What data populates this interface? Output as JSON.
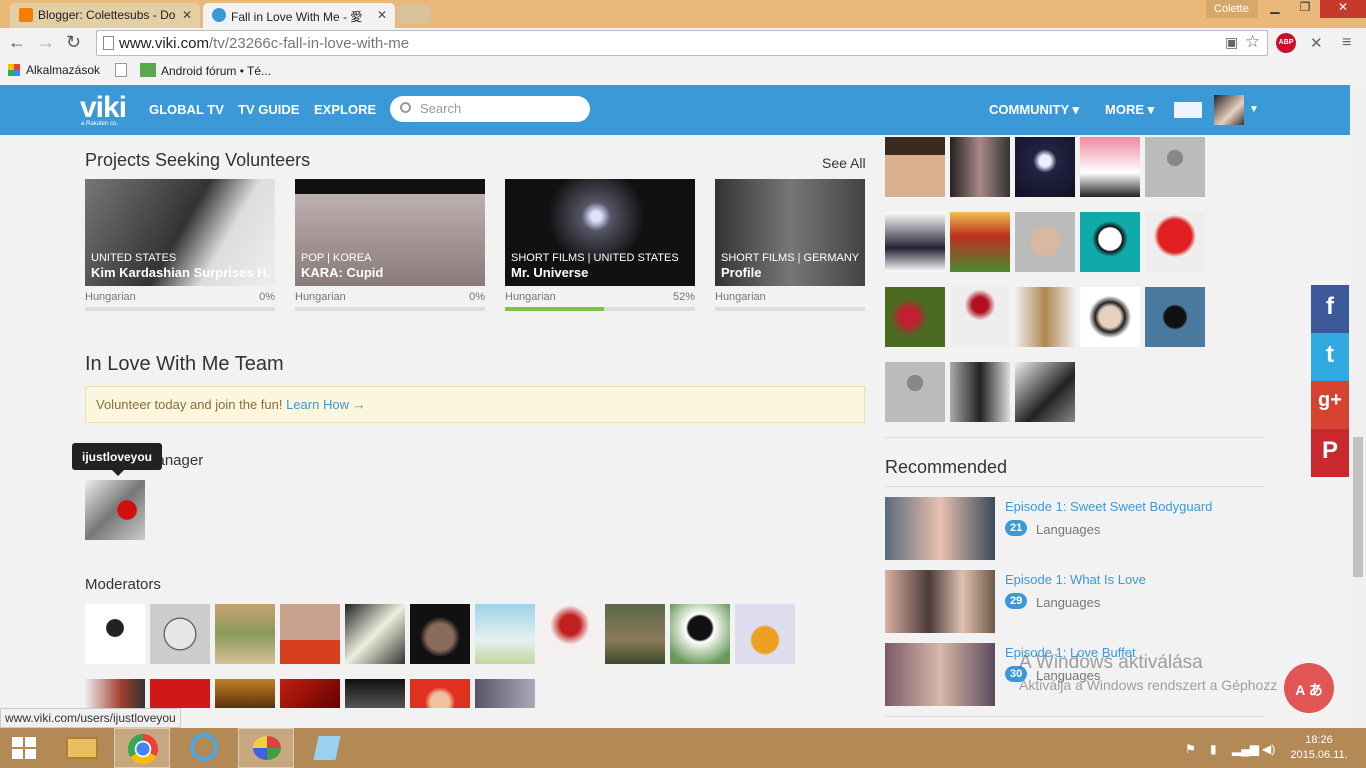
{
  "browser": {
    "tabs": [
      {
        "title": "Blogger: Colettesubs - Do",
        "favicon_color": "#f57d00"
      },
      {
        "title": "Fall in Love With Me - 愛",
        "favicon_color": "#3b99d8"
      }
    ],
    "window_user": "Colette",
    "url_host": "www.viki.com",
    "url_path": "/tv/23266c-fall-in-love-with-me",
    "abp_count": "ABP",
    "bookmarks": [
      "Alkalmazások",
      "Android fórum • Té..."
    ]
  },
  "viki": {
    "logo": "viki",
    "logo_sub": "a Rakuten co.",
    "nav": [
      "GLOBAL TV",
      "TV GUIDE",
      "EXPLORE"
    ],
    "search_placeholder": "Search",
    "right_nav": [
      "COMMUNITY",
      "MORE"
    ]
  },
  "projects": {
    "title": "Projects Seeking Volunteers",
    "see_all": "See All",
    "cards": [
      {
        "tag": "UNITED STATES",
        "title": "Kim Kardashian Surprises H...",
        "lang": "Hungarian",
        "pct": "0%",
        "progress": 0,
        "color": "#5a5a5a"
      },
      {
        "tag": "POP | KOREA",
        "title": "KARA: Cupid",
        "lang": "Hungarian",
        "pct": "0%",
        "progress": 0,
        "color": "#9a8a8a"
      },
      {
        "tag": "SHORT FILMS | UNITED STATES",
        "title": "Mr. Universe",
        "lang": "Hungarian",
        "pct": "52%",
        "progress": 0.52,
        "color": "#222233"
      },
      {
        "tag": "SHORT FILMS | GERMANY",
        "title": "Profile",
        "lang": "Hungarian",
        "pct": "",
        "progress": 0,
        "color": "#4a4a4a"
      }
    ]
  },
  "team": {
    "title": "In Love With Me Team",
    "volunteer_text": "Volunteer today and join the fun! ",
    "volunteer_link": "Learn How →",
    "tooltip": "ijustloveyou",
    "manager_heading": "Manager",
    "moderators_heading": "Moderators",
    "status_url": "www.viki.com/users/ijustloveyou"
  },
  "recommended": {
    "title": "Recommended",
    "items": [
      {
        "title": "Episode 1: Sweet Sweet Bodyguard",
        "count": "21",
        "label": "Languages",
        "color": "#6a7a8a"
      },
      {
        "title": "Episode 1: What Is Love",
        "count": "29",
        "label": "Languages",
        "color": "#8a6a5a"
      },
      {
        "title": "Episode 1: Love Buffet",
        "count": "30",
        "label": "Languages",
        "color": "#7a5a6a"
      }
    ]
  },
  "overlay": {
    "win_title": "A Windows aktiválása",
    "win_sub": "Aktiválja a Windows rendszert a Géphozz",
    "chat": "A あ"
  },
  "social": [
    {
      "name": "facebook",
      "glyph": "f",
      "color": "#3b5998"
    },
    {
      "name": "twitter",
      "glyph": "t",
      "color": "#2fa9e0"
    },
    {
      "name": "googleplus",
      "glyph": "g+",
      "color": "#d64330"
    },
    {
      "name": "pinterest",
      "glyph": "P",
      "color": "#c9282d"
    }
  ],
  "taskbar": {
    "time": "18:26",
    "date": "2015.06.11."
  }
}
